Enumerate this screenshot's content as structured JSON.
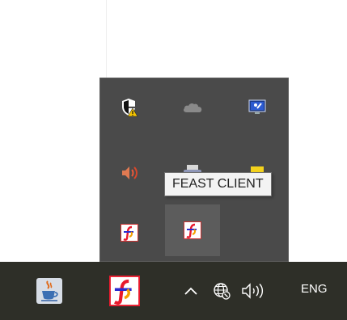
{
  "tooltip": {
    "text": "FEAST CLIENT"
  },
  "tray_overflow": {
    "icons": [
      {
        "name": "windows-security-warning-icon",
        "hovered": false
      },
      {
        "name": "onedrive-icon",
        "hovered": false
      },
      {
        "name": "network-monitor-icon",
        "hovered": false
      },
      {
        "name": "speaker-icon",
        "hovered": false
      },
      {
        "name": "printer-icon",
        "hovered": false
      },
      {
        "name": "sticky-notes-icon",
        "hovered": false
      },
      {
        "name": "feast-client-icon",
        "hovered": false
      },
      {
        "name": "feast-client-icon",
        "hovered": true
      }
    ]
  },
  "taskbar": {
    "apps": [
      {
        "name": "java-icon"
      },
      {
        "name": "feast-client-icon"
      }
    ],
    "tray": {
      "chevron": "chevron-up-icon",
      "network": "globe-network-icon",
      "volume": "volume-icon",
      "language": "ENG"
    }
  },
  "colors": {
    "flyout_bg": "#4a4a4a",
    "flyout_hover": "#5c5c5c",
    "taskbar_bg": "#2e2f28",
    "tooltip_bg": "#f3f3f3",
    "feast_red": "#e8192c"
  }
}
